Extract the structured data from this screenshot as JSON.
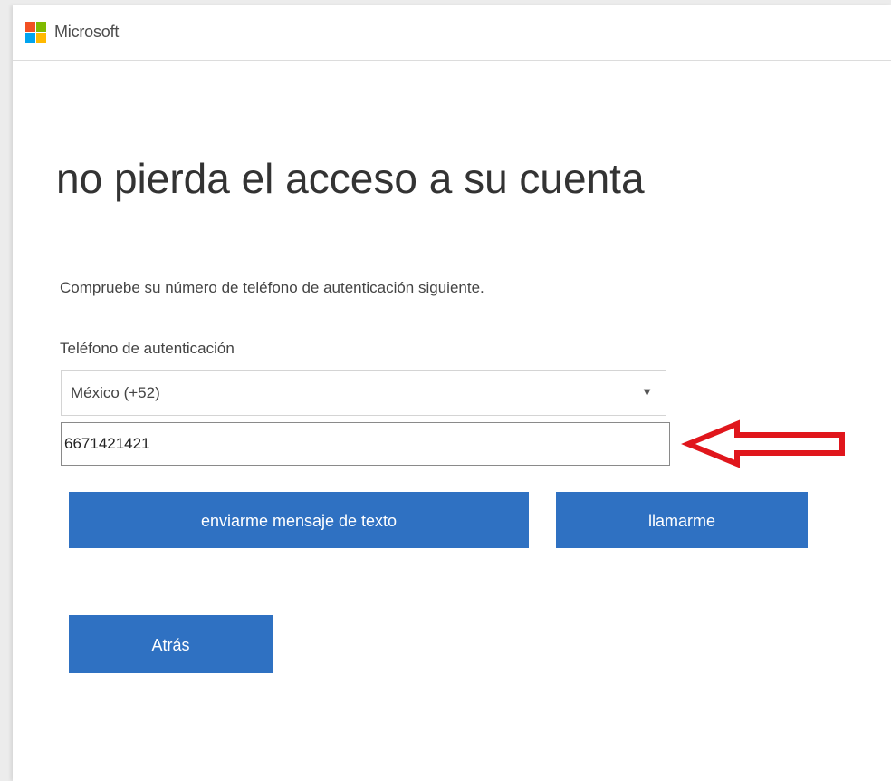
{
  "header": {
    "brand": "Microsoft",
    "logo_colors": [
      "#f25022",
      "#7fba00",
      "#00a4ef",
      "#ffb900"
    ]
  },
  "page": {
    "title": "no pierda el acceso a su cuenta",
    "description": "Compruebe su número de teléfono de autenticación siguiente."
  },
  "form": {
    "phone_label": "Teléfono de autenticación",
    "country_selected": "México (+52)",
    "phone_value": "6671421421"
  },
  "buttons": {
    "text_me": "enviarme mensaje de texto",
    "call_me": "llamarme",
    "back": "Atrás"
  },
  "annotation": {
    "arrow_color": "#e0161c",
    "icon": "left-arrow-annotation"
  },
  "colors": {
    "button_blue": "#2f71c2"
  }
}
